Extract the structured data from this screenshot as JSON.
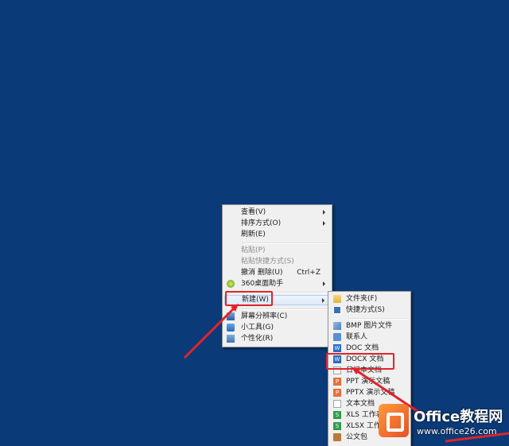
{
  "colors": {
    "desktop": "#0b3a78",
    "highlight_box": "#e0242a"
  },
  "context_menu": {
    "view": "查看(V)",
    "sort": "排序方式(O)",
    "refresh": "刷新(E)",
    "paste": "粘贴(P)",
    "paste_shortcut": "粘贴快捷方式(S)",
    "undo_delete": "撤消 删除(U)",
    "undo_shortcut": "Ctrl+Z",
    "assistant_360": "360桌面助手",
    "new": "新建(W)",
    "resolution": "屏幕分辨率(C)",
    "gadgets": "小工具(G)",
    "personalize": "个性化(R)"
  },
  "submenu": {
    "folder": "文件夹(F)",
    "shortcut": "快捷方式(S)",
    "bmp": "BMP 图片文件",
    "contact": "联系人",
    "doc": "DOC 文档",
    "docx": "DOCX 文档",
    "journal": "日记本文档",
    "ppt": "PPT 演示文稿",
    "pptx": "PPTX 演示文稿",
    "text": "文本文档",
    "xls": "XLS 工作表",
    "xlsx": "XLSX 工作表",
    "briefcase": "公文包"
  },
  "watermark": {
    "title": "Office教程网",
    "url": "www.office26.com"
  }
}
